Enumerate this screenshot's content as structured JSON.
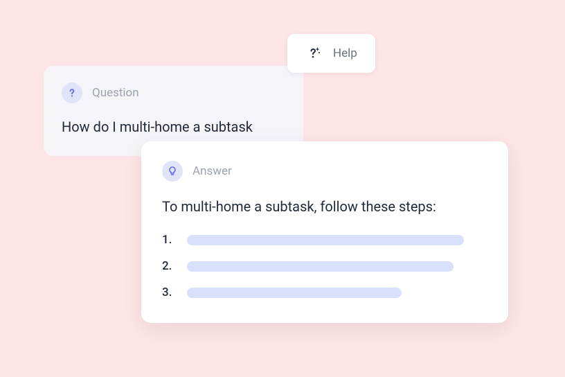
{
  "help_chip": {
    "label": "Help"
  },
  "question": {
    "label": "Question",
    "text": "How do I multi-home a subtask"
  },
  "answer": {
    "label": "Answer",
    "intro": "To multi-home a subtask, follow these steps:",
    "steps": [
      {
        "number": "1."
      },
      {
        "number": "2."
      },
      {
        "number": "3."
      }
    ]
  },
  "colors": {
    "background": "#fde4e7",
    "question_card_bg": "#f5f4f9",
    "answer_card_bg": "#ffffff",
    "icon_badge_bg": "#e1e4f9",
    "step_bar": "#d9e0fb",
    "text_primary": "#1f2937",
    "text_muted": "#9ca3af"
  }
}
